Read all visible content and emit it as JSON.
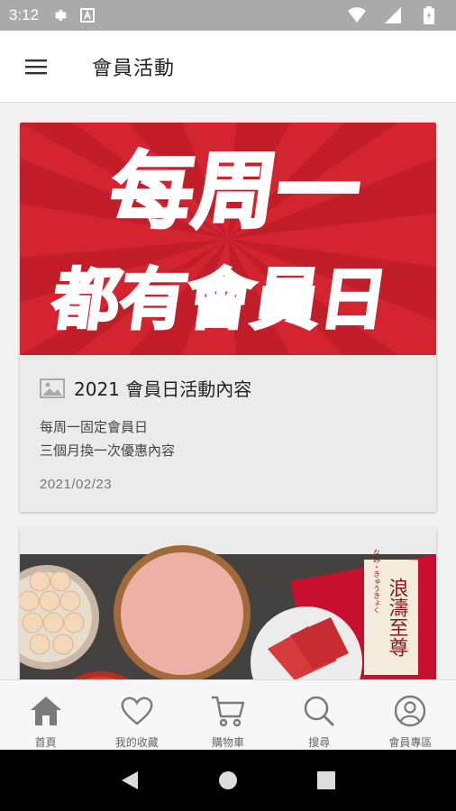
{
  "status_bar": {
    "time": "3:12",
    "icons": [
      "gear-icon",
      "a-icon",
      "wifi-icon",
      "signal-icon",
      "battery-icon"
    ]
  },
  "app_bar": {
    "title": "會員活動",
    "menu_icon": "hamburger-icon"
  },
  "cards": [
    {
      "banner_line1": "每周一",
      "banner_line2": "都有會員日",
      "title": "2021 會員日活動內容",
      "description_lines": [
        "每周一固定會員日",
        "三個月換一次優惠內容"
      ],
      "date": "2021/02/23"
    },
    {
      "banner_badge_line1": "浪濤",
      "banner_badge_line2": "至尊",
      "banner_badge_sub": "なみ・きゅうきょく"
    }
  ],
  "bottom_nav": {
    "items": [
      {
        "label": "首頁",
        "icon": "home-icon"
      },
      {
        "label": "我的收藏",
        "icon": "heart-icon"
      },
      {
        "label": "購物車",
        "icon": "cart-icon"
      },
      {
        "label": "搜尋",
        "icon": "search-icon"
      },
      {
        "label": "會員專區",
        "icon": "user-icon"
      }
    ]
  },
  "colors": {
    "banner_red": "#d42430",
    "status_bar": "#aaaaaa",
    "nav_icon": "#777777"
  }
}
